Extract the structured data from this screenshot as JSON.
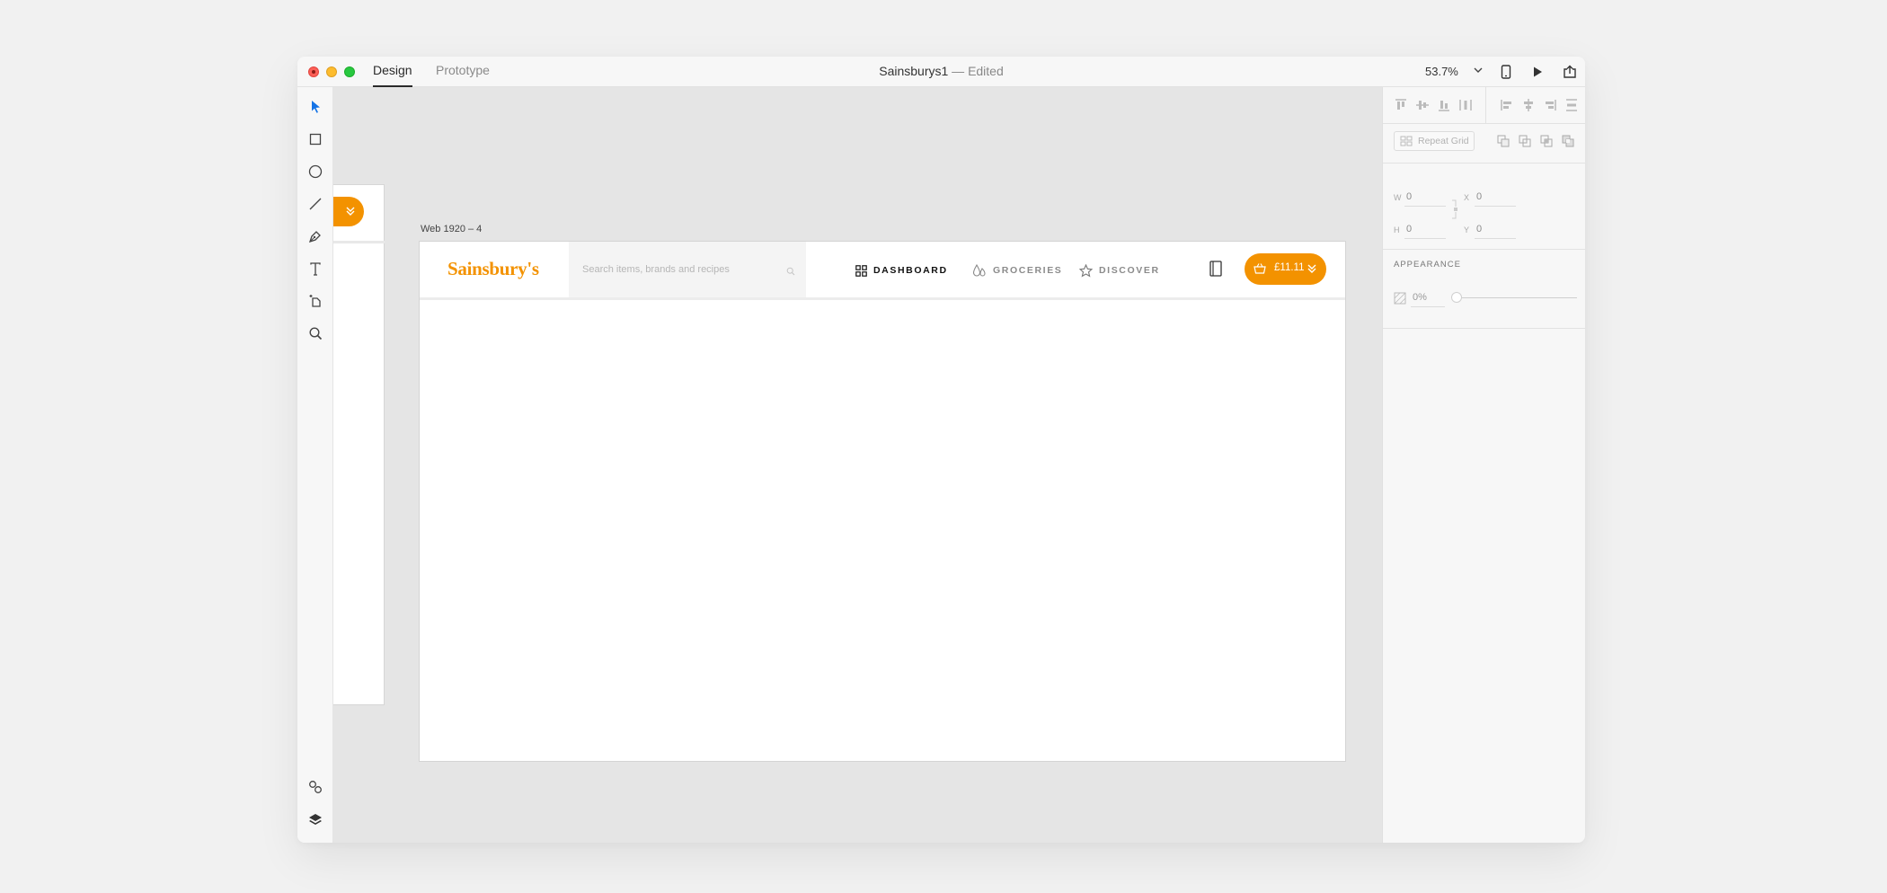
{
  "titlebar": {
    "tabs": [
      {
        "label": "Design",
        "active": true
      },
      {
        "label": "Prototype",
        "active": false
      }
    ],
    "document_name": "Sainsburys1",
    "separator": "—",
    "status": "Edited",
    "zoom": "53.7%"
  },
  "toolbar": {
    "tools": [
      "select-icon",
      "rectangle-icon",
      "ellipse-icon",
      "line-icon",
      "pen-icon",
      "text-icon",
      "artboard-icon",
      "zoom-icon"
    ],
    "bottom_tools": [
      "assets-icon",
      "layers-icon"
    ]
  },
  "canvas": {
    "artboard_label": "Web 1920 – 4",
    "site": {
      "logo": "Sainsbury's",
      "search_placeholder": "Search items, brands and recipes",
      "nav": [
        {
          "label": "DASHBOARD",
          "icon": "grid-icon",
          "active": true
        },
        {
          "label": "GROCERIES",
          "icon": "drops-icon",
          "active": false
        },
        {
          "label": "DISCOVER",
          "icon": "star-icon",
          "active": false
        }
      ],
      "basket_amount": "£11.11"
    }
  },
  "panel": {
    "repeat_grid": "Repeat Grid",
    "fields": {
      "w_label": "W",
      "w": "0",
      "x_label": "X",
      "x": "0",
      "h_label": "H",
      "h": "0",
      "y_label": "Y",
      "y": "0"
    },
    "appearance_heading": "APPEARANCE",
    "opacity": "0%"
  },
  "colors": {
    "brand_orange": "#f39200",
    "select_blue": "#1473e6",
    "canvas_bg": "#e5e5e5"
  }
}
